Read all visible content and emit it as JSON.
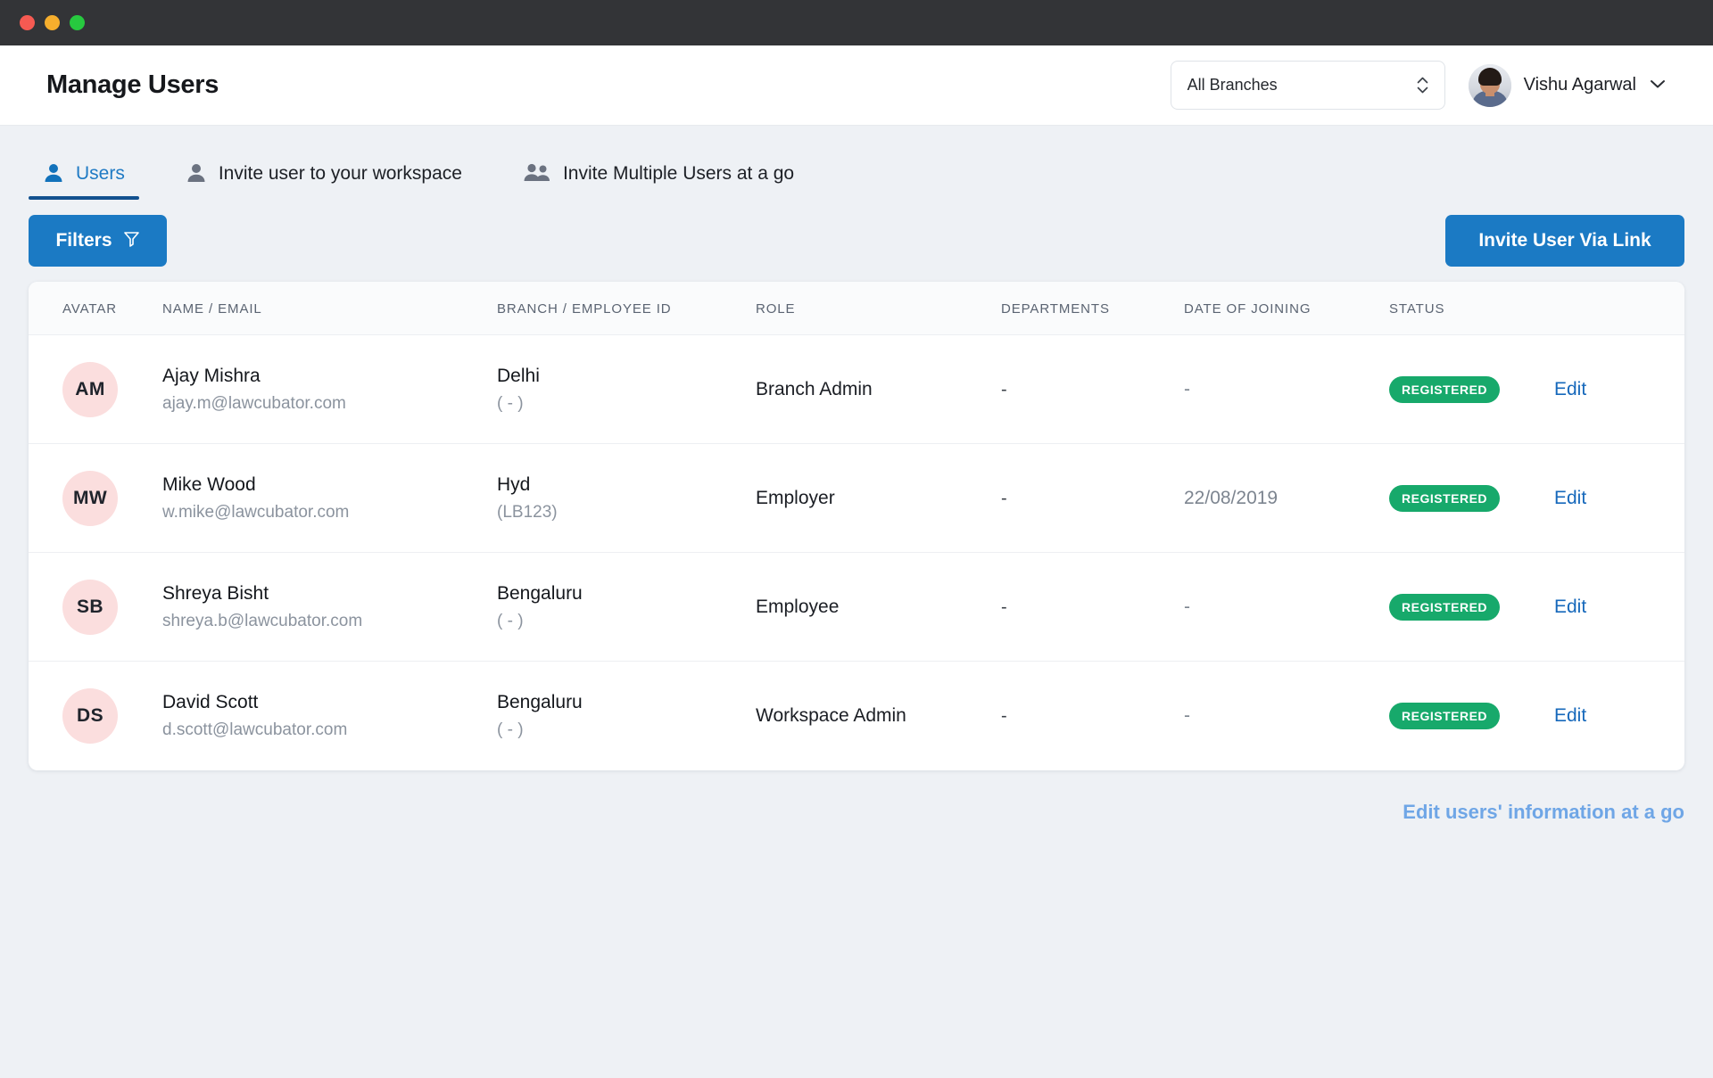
{
  "window": {
    "traffic_lights": [
      "close",
      "minimize",
      "zoom"
    ]
  },
  "header": {
    "title": "Manage Users",
    "branch_select": {
      "value": "All Branches",
      "icon": "updown-chevron-icon"
    },
    "user": {
      "name": "Vishu Agarwal",
      "caret_icon": "chevron-down-icon",
      "avatar_icon": "user-photo-avatar"
    }
  },
  "tabs": [
    {
      "label": "Users",
      "icon": "single-user-icon",
      "active": true
    },
    {
      "label": "Invite user to your workspace",
      "icon": "single-user-icon",
      "active": false
    },
    {
      "label": "Invite Multiple Users at a go",
      "icon": "multiple-users-icon",
      "active": false
    }
  ],
  "actions": {
    "filters_label": "Filters",
    "filters_icon": "funnel-icon",
    "invite_label": "Invite User Via Link"
  },
  "table": {
    "columns": [
      "AVATAR",
      "NAME / EMAIL",
      "BRANCH / EMPLOYEE ID",
      "ROLE",
      "DEPARTMENTS",
      "DATE OF JOINING",
      "STATUS",
      ""
    ],
    "rows": [
      {
        "initials": "AM",
        "name": "Ajay Mishra",
        "email": "ajay.m@lawcubator.com",
        "branch": "Delhi",
        "employee_id": "( - )",
        "role": "Branch Admin",
        "departments": "-",
        "date_of_joining": "-",
        "status": "REGISTERED",
        "edit_label": "Edit"
      },
      {
        "initials": "MW",
        "name": "Mike Wood",
        "email": "w.mike@lawcubator.com",
        "branch": "Hyd",
        "employee_id": "(LB123)",
        "role": "Employer",
        "departments": "-",
        "date_of_joining": "22/08/2019",
        "status": "REGISTERED",
        "edit_label": "Edit"
      },
      {
        "initials": "SB",
        "name": "Shreya Bisht",
        "email": "shreya.b@lawcubator.com",
        "branch": "Bengaluru",
        "employee_id": "( - )",
        "role": "Employee",
        "departments": "-",
        "date_of_joining": "-",
        "status": "REGISTERED",
        "edit_label": "Edit"
      },
      {
        "initials": "DS",
        "name": "David Scott",
        "email": "d.scott@lawcubator.com",
        "branch": "Bengaluru",
        "employee_id": "( - )",
        "role": "Workspace Admin",
        "departments": "-",
        "date_of_joining": "-",
        "status": "REGISTERED",
        "edit_label": "Edit"
      }
    ]
  },
  "footer": {
    "bulk_edit_label": "Edit users' information at a go"
  },
  "colors": {
    "accent_blue": "#1b7ac4",
    "active_tab_blue": "#1f7ac4",
    "status_green": "#17a96b",
    "avatar_pink": "#fbdede",
    "footer_link_blue": "#6fa6e6",
    "page_background": "#eef1f5",
    "titlebar": "#333437"
  }
}
